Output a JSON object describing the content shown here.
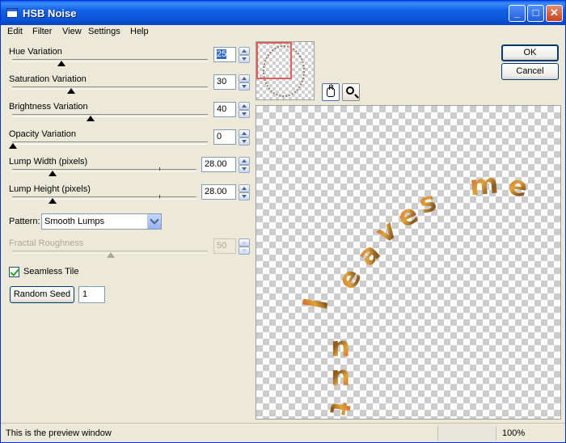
{
  "window": {
    "title": "HSB Noise"
  },
  "menu": [
    "Edit",
    "Filter",
    "View",
    "Settings",
    "Help"
  ],
  "controls": {
    "hue": {
      "label": "Hue Variation",
      "value": "25"
    },
    "saturation": {
      "label": "Saturation Variation",
      "value": "30"
    },
    "brightness": {
      "label": "Brightness Variation",
      "value": "40"
    },
    "opacity": {
      "label": "Opacity Variation",
      "value": "0"
    },
    "lump_width": {
      "label": "Lump Width (pixels)",
      "value": "28.00"
    },
    "lump_height": {
      "label": "Lump Height (pixels)",
      "value": "28.00"
    },
    "pattern": {
      "label": "Pattern:",
      "value": "Smooth Lumps"
    },
    "fractal": {
      "label": "Fractal Roughness",
      "value": "50"
    },
    "seamless": {
      "label": "Seamless Tile",
      "checked": true
    },
    "random_seed": {
      "label": "Random Seed",
      "value": "1"
    }
  },
  "buttons": {
    "ok": "OK",
    "cancel": "Cancel"
  },
  "preview": {
    "letters": [
      "l",
      "e",
      "a",
      "v",
      "e",
      "s",
      "m",
      "e",
      "u",
      "u",
      "t"
    ]
  },
  "status": {
    "text": "This is the preview window",
    "zoom": "100%"
  }
}
